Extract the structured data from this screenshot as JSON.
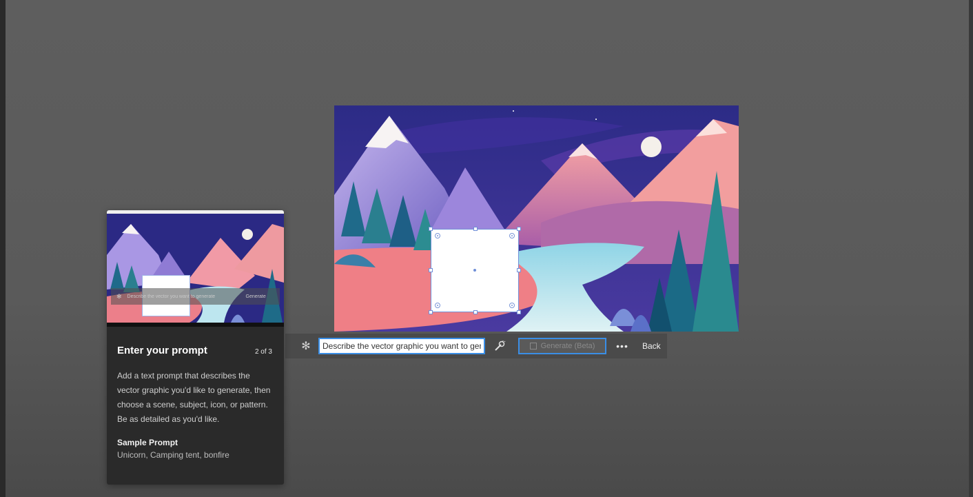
{
  "taskbar": {
    "prompt_placeholder": "Describe the vector graphic you want to generate",
    "generate_label": "Generate (Beta)",
    "more_label": "•••",
    "back_label": "Back",
    "accent_color": "#3a8ee6"
  },
  "tour_card": {
    "title": "Enter your prompt",
    "step": "2 of 3",
    "description": "Add a text prompt that describes the vector graphic you'd like to generate, then choose a scene, subject, icon, or pattern. Be as detailed as you'd like.",
    "sample_label": "Sample Prompt",
    "sample_text": "Unicorn, Camping tent, bonfire",
    "thumb_prompt_text": "Describe the vector you want to generate",
    "thumb_button_text": "Generate"
  },
  "icons": {
    "generate": "sparkle-icon",
    "sample_prompts": "wand-icon",
    "generate_button": "generate-frame-icon"
  }
}
